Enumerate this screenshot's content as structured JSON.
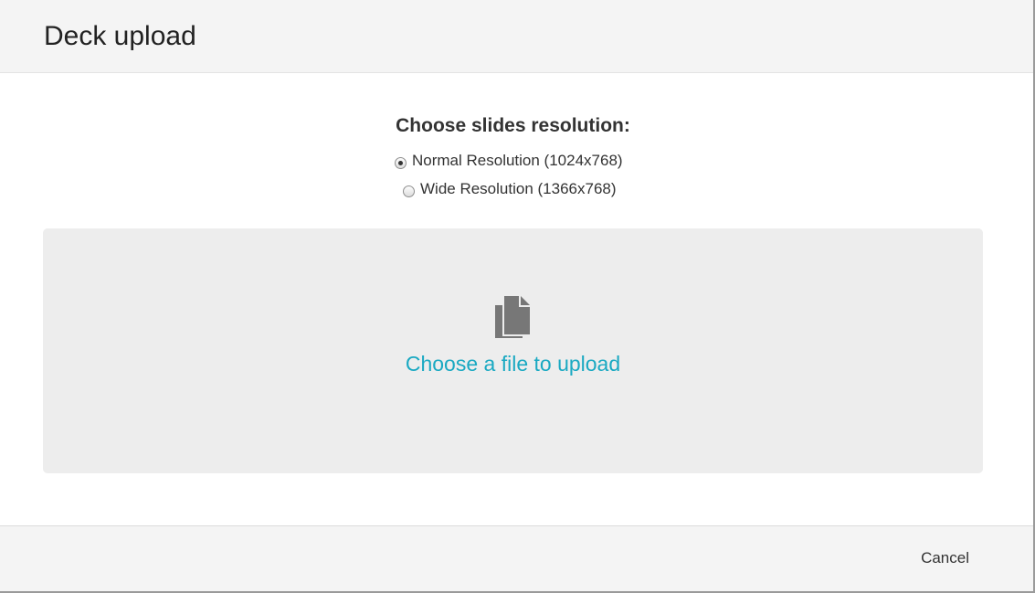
{
  "dialog": {
    "title": "Deck upload"
  },
  "resolution": {
    "heading": "Choose slides resolution:",
    "options": [
      {
        "label": "Normal Resolution (1024x768)",
        "selected": true
      },
      {
        "label": "Wide Resolution (1366x768)",
        "selected": false
      }
    ]
  },
  "dropzone": {
    "icon": "files-icon",
    "label": "Choose a file to upload"
  },
  "footer": {
    "cancel_label": "Cancel"
  },
  "colors": {
    "link": "#1aa9c2",
    "dropzone_bg": "#ededed",
    "header_bg": "#f4f4f4",
    "icon": "#777777"
  }
}
